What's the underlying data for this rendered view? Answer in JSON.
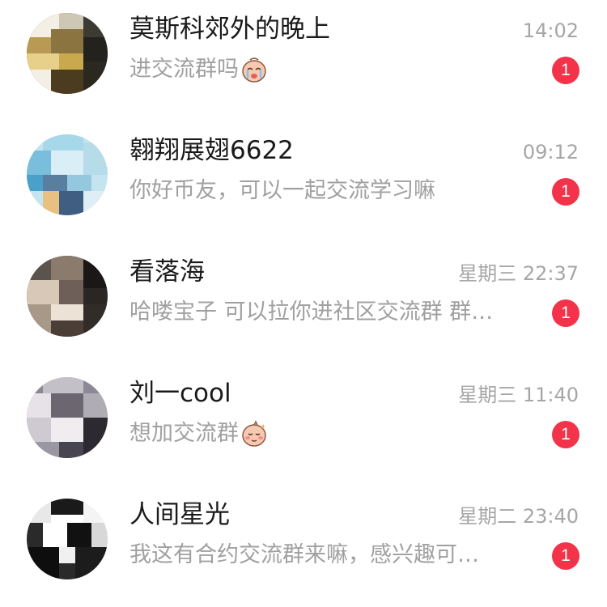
{
  "conversations": [
    {
      "name": "莫斯科郊外的晚上",
      "time": "14:02",
      "preview": "进交流群吗",
      "emoji": "crying-face-emoji",
      "unread": "1"
    },
    {
      "name": "翱翔展翅6622",
      "time": "09:12",
      "preview": "你好币友，可以一起交流学习嘛",
      "emoji": "",
      "unread": "1"
    },
    {
      "name": "看落海",
      "time": "星期三 22:37",
      "preview": "哈喽宝子 可以拉你进社区交流群 群…",
      "emoji": "",
      "unread": "1"
    },
    {
      "name": "刘一cool",
      "time": "星期三 11:40",
      "preview": "想加交流群",
      "emoji": "shy-face-emoji",
      "unread": "1"
    },
    {
      "name": "人间星光",
      "time": "星期二 23:40",
      "preview": "我这有合约交流群来嘛，感兴趣可…",
      "emoji": "",
      "unread": "1"
    }
  ],
  "colors": {
    "badge": "#f2334a",
    "name_text": "#1a1a1a",
    "secondary_text": "#a0a0a0"
  }
}
